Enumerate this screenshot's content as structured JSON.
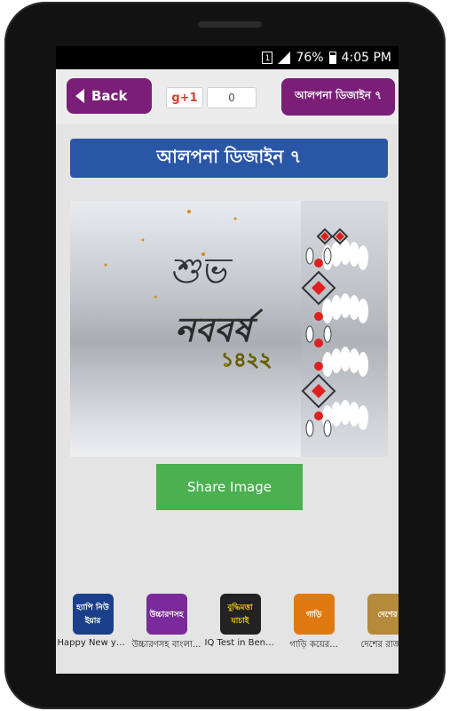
{
  "status_bar": {
    "sim": "1",
    "battery": "76%",
    "time": "4:05 PM"
  },
  "top_bar": {
    "back_label": "Back",
    "gplus_label": "g+1",
    "gplus_count": "0",
    "title_button": "আলপনা ডিজাইন ৭"
  },
  "header": {
    "title": "আলপনা ডিজাইন ৭"
  },
  "image": {
    "line1": "শুভ",
    "line2": "নববর্ষ",
    "year": "১৪২২"
  },
  "share_button": "Share Image",
  "apps": [
    {
      "label": "Happy New year...",
      "icon_text": "হ্যাপি নিউ ইয়ার",
      "color": "#1b3f8a"
    },
    {
      "label": "উচ্চারণসহ বাংলা...",
      "icon_text": "উচ্চারণসহ",
      "color": "#7a2a9a"
    },
    {
      "label": "IQ Test in Bengali",
      "icon_text": "বুদ্ধিমত্তা যাচাই",
      "color": "#222222"
    },
    {
      "label": "গাড়ি কয়ের...",
      "icon_text": "গাড়ি",
      "color": "#e07a10"
    },
    {
      "label": "দেশের রাজধ...",
      "icon_text": "দেশের",
      "color": "#b58a3a"
    }
  ]
}
